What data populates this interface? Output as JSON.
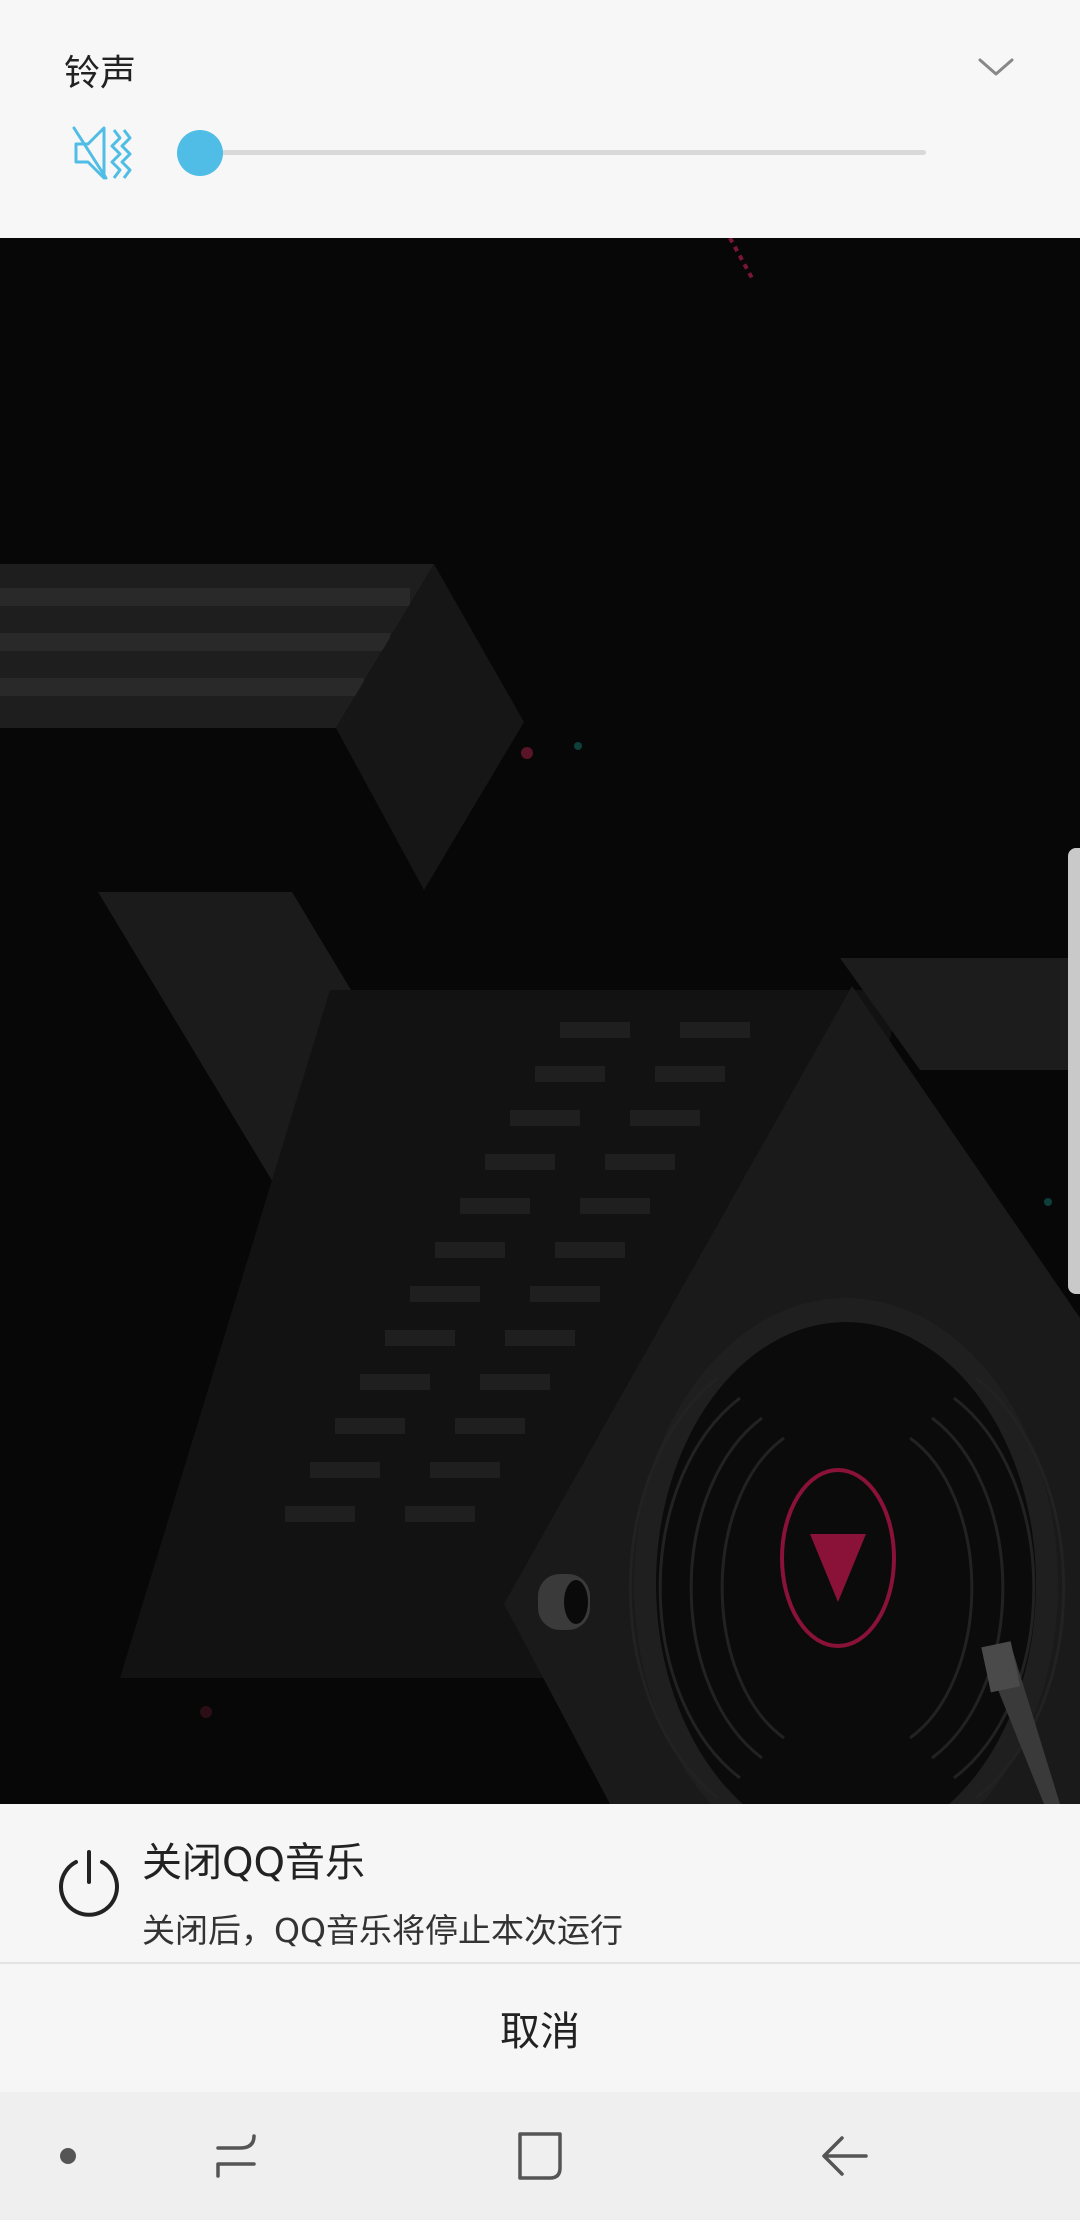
{
  "volume_panel": {
    "title": "铃声",
    "level": 0,
    "accent_color": "#4fbde5",
    "icons": {
      "expand": "chevron-down-icon",
      "ringer": "ringer-muted-icon"
    }
  },
  "artwork": {
    "description_icon": "qq-music-player-artwork",
    "accent_color": "#8a1238"
  },
  "sheet": {
    "option_icon": "power-icon",
    "option_title": "关闭QQ音乐",
    "option_subtitle": "关闭后，QQ音乐将停止本次运行",
    "cancel_label": "取消"
  },
  "nav_bar": {
    "icons": [
      "indicator-dot-icon",
      "recent-apps-icon",
      "home-icon",
      "back-icon"
    ]
  }
}
